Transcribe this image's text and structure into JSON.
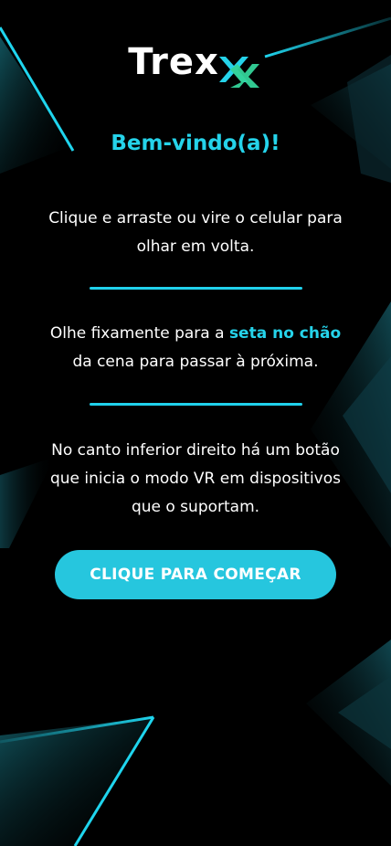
{
  "brand": {
    "name": "Trex",
    "accent_color": "#25d3ea",
    "logo_mark_colors": [
      "#25d3ea",
      "#34d399"
    ]
  },
  "welcome": {
    "title": "Bem-vindo(a)!"
  },
  "instructions": {
    "p1": "Clique e arraste ou vire o celular para olhar em volta.",
    "p2_before": "Olhe fixamente para a ",
    "p2_highlight": "seta no chão",
    "p2_after": " da cena para passar à próxima.",
    "p3": "No canto inferior direito há um botão que inicia o modo VR em dispositivos que o suportam."
  },
  "cta": {
    "label": "CLIQUE PARA COMEÇAR",
    "color": "#26c6de"
  },
  "background": {
    "color": "#000000",
    "line_color": "#1fd5ee"
  }
}
